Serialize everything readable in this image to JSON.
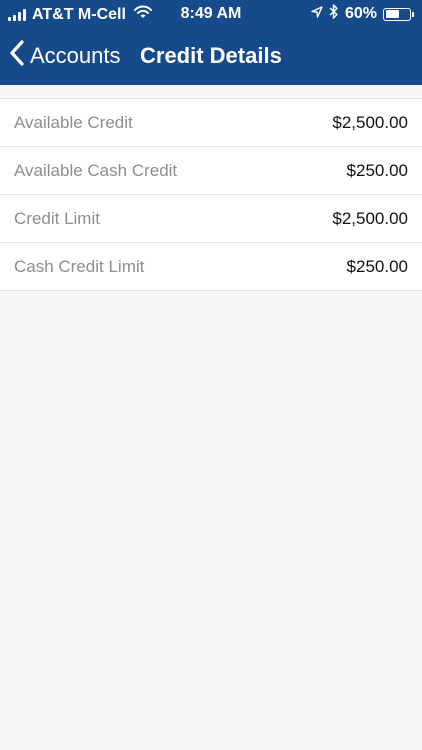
{
  "status_bar": {
    "carrier": "AT&T M-Cell",
    "time": "8:49 AM",
    "battery_percent": "60%",
    "battery_level": 0.6,
    "icons": [
      "signal-bars-icon",
      "wifi-icon",
      "location-arrow-icon",
      "bluetooth-icon",
      "battery-icon"
    ]
  },
  "nav": {
    "back_label": "Accounts",
    "title": "Credit Details",
    "back_icon": "chevron-left-icon"
  },
  "credit_details": [
    {
      "label": "Available Credit",
      "value": "$2,500.00"
    },
    {
      "label": "Available Cash Credit",
      "value": "$250.00"
    },
    {
      "label": "Credit Limit",
      "value": "$2,500.00"
    },
    {
      "label": "Cash Credit Limit",
      "value": "$250.00"
    }
  ],
  "colors": {
    "header_background": "#174a8b",
    "page_background": "#f7f7f7",
    "label_text": "#8e8e8e",
    "value_text": "#111111"
  }
}
